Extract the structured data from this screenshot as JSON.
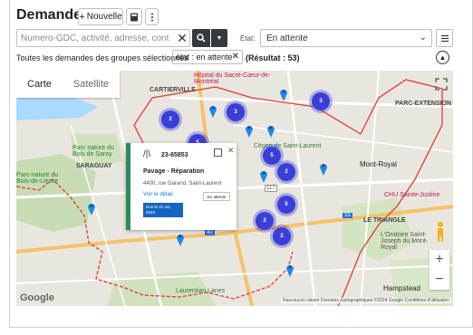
{
  "header": {
    "title": "Demandes",
    "new_label": "Nouvelle",
    "new_plus": "+"
  },
  "search": {
    "placeholder": "Numero-GDC, activité, adresse, contremaître,",
    "clear": "✕"
  },
  "state_filter": {
    "label": "État:",
    "selected": "En attente"
  },
  "filter_bar": {
    "scope_text": "Toutes les demandes des groupes sélectionnés",
    "chip_label": "état : en attente",
    "chip_remove": "✕",
    "result_text": "(Résultat : 53)"
  },
  "map": {
    "tabs": [
      {
        "label": "Carte",
        "active": true
      },
      {
        "label": "Satellite",
        "active": false
      }
    ],
    "google": "Google",
    "attribution": "Raccourcis clavier   Données cartographiques ©2024 Google   Conditions d'utilisation",
    "labels": {
      "hospital": "Hôpital du Sacré-Cœur-de-Montréal",
      "cartierville": "CARTIERVILLE",
      "parc_extension": "PARC-EXTENSION",
      "cegep": "Cégep de Saint-Laurent",
      "mont_royal": "Mont-Royal",
      "parc_bois": "Parc-nature du Bois-de-Liesse",
      "parc_nature": "Parc nature du Bois de Saray",
      "saraguay": "SARAGUAY",
      "chu": "CHU Sainte-Justine",
      "triangle": "LE TRIANGLE",
      "oratoire": "L'Oratoire Saint-Joseph du Mont-Royal",
      "hampstead": "Hampstead",
      "laurentian": "Laurentian Lanes",
      "road_15": "15",
      "road_40": "40",
      "road_117": "117"
    },
    "clusters": [
      "2",
      "3",
      "3",
      "5",
      "5",
      "2",
      "2",
      "2",
      "5",
      "2"
    ],
    "info_window": {
      "number": "23-65853",
      "type": "Pavage - Réparation",
      "address": "4400, rue Garand, Saint-Laurent",
      "detail_link": "Voir le détail",
      "status": "En attente",
      "due": "Due le 31 oct. 2023",
      "close": "✕"
    }
  },
  "colors": {
    "cluster": "#3b3fd8",
    "pin": "#1e88e5",
    "boundary": "#e53935",
    "info_accent": "#2e8b57",
    "dark_button": "#343a40"
  }
}
